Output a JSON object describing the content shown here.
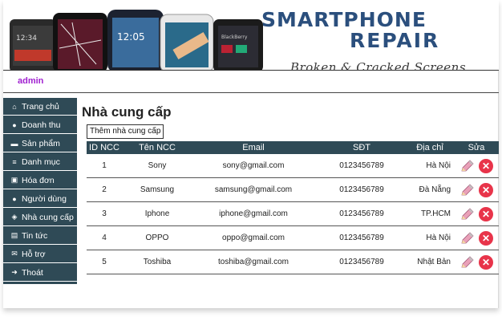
{
  "banner": {
    "brand_line1": "SMARTPHONE",
    "brand_line2": "REPAIR",
    "tagline": "Broken & Cracked Screens",
    "phones": [
      "htc-phone-icon",
      "iphone-icon",
      "samsung-phone-icon",
      "iphone-white-icon",
      "blackberry-phone-icon"
    ]
  },
  "user": {
    "name": "admin"
  },
  "sidebar": {
    "items": [
      {
        "label": "Trang chủ",
        "icon": "home-icon",
        "glyph": "⌂"
      },
      {
        "label": "Doanh thu",
        "icon": "money-icon",
        "glyph": "●"
      },
      {
        "label": "Sản phẩm",
        "icon": "box-icon",
        "glyph": "▬"
      },
      {
        "label": "Danh mục",
        "icon": "list-icon",
        "glyph": "≡"
      },
      {
        "label": "Hóa đơn",
        "icon": "calendar-check-icon",
        "glyph": "▣"
      },
      {
        "label": "Người dùng",
        "icon": "user-icon",
        "glyph": "●"
      },
      {
        "label": "Nhà cung cấp",
        "icon": "handshake-icon",
        "glyph": "◈"
      },
      {
        "label": "Tin tức",
        "icon": "news-icon",
        "glyph": "▤"
      },
      {
        "label": "Hỗ trợ",
        "icon": "envelope-icon",
        "glyph": "✉"
      },
      {
        "label": "Thoát",
        "icon": "sign-out-icon",
        "glyph": "➜"
      }
    ]
  },
  "main": {
    "title": "Nhà cung cấp",
    "add_label": "Thêm nhà cung cấp",
    "columns": [
      "ID NCC",
      "Tên NCC",
      "Email",
      "SĐT",
      "Địa chỉ",
      "Sửa"
    ],
    "rows": [
      {
        "id": "1",
        "name": "Sony",
        "email": "sony@gmail.com",
        "phone": "0123456789",
        "address": "Hà Nội"
      },
      {
        "id": "2",
        "name": "Samsung",
        "email": "samsung@gmail.com",
        "phone": "0123456789",
        "address": "Đà Nẵng"
      },
      {
        "id": "3",
        "name": "Iphone",
        "email": "iphone@gmail.com",
        "phone": "0123456789",
        "address": "TP.HCM"
      },
      {
        "id": "4",
        "name": "OPPO",
        "email": "oppo@gmail.com",
        "phone": "0123456789",
        "address": "Hà Nội"
      },
      {
        "id": "5",
        "name": "Toshiba",
        "email": "toshiba@gmail.com",
        "phone": "0123456789",
        "address": "Nhật Bản"
      }
    ],
    "edit_icon": "pencil-icon",
    "delete_icon": "close-circle-icon",
    "delete_glyph": "✕"
  },
  "colors": {
    "brand": "#2b4f7d",
    "sidebar_bg": "#2f4a56",
    "user_name": "#a020d0",
    "delete": "#e8344a"
  }
}
